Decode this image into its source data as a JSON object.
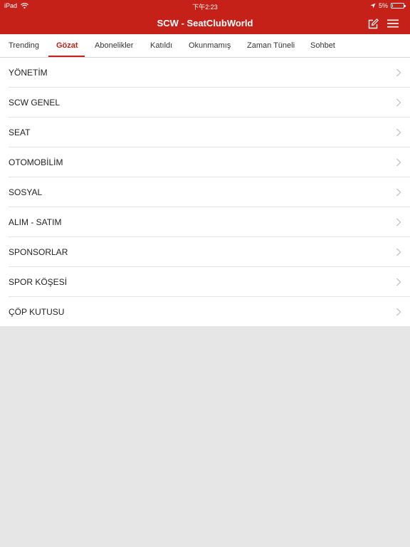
{
  "status_bar": {
    "device": "iPad",
    "time": "下午2:23",
    "battery_percent_label": "5%",
    "battery_level": 0.05
  },
  "nav": {
    "title": "SCW - SeatClubWorld",
    "compose_icon": "compose-icon",
    "menu_icon": "hamburger-menu-icon"
  },
  "tabs": [
    {
      "label": "Trending",
      "active": false
    },
    {
      "label": "Gözat",
      "active": true
    },
    {
      "label": "Abonelikler",
      "active": false
    },
    {
      "label": "Katıldı",
      "active": false
    },
    {
      "label": "Okunmamış",
      "active": false
    },
    {
      "label": "Zaman Tüneli",
      "active": false
    },
    {
      "label": "Sohbet",
      "active": false
    }
  ],
  "categories": [
    {
      "label": "YÖNETİM"
    },
    {
      "label": "SCW GENEL"
    },
    {
      "label": "SEAT"
    },
    {
      "label": "OTOMOBİLİM"
    },
    {
      "label": "SOSYAL"
    },
    {
      "label": "ALIM - SATIM"
    },
    {
      "label": "SPONSORLAR"
    },
    {
      "label": "SPOR KÖŞESİ"
    },
    {
      "label": "ÇÖP KUTUSU"
    }
  ],
  "colors": {
    "brand": "#c62119",
    "background": "#e6e6e6"
  }
}
